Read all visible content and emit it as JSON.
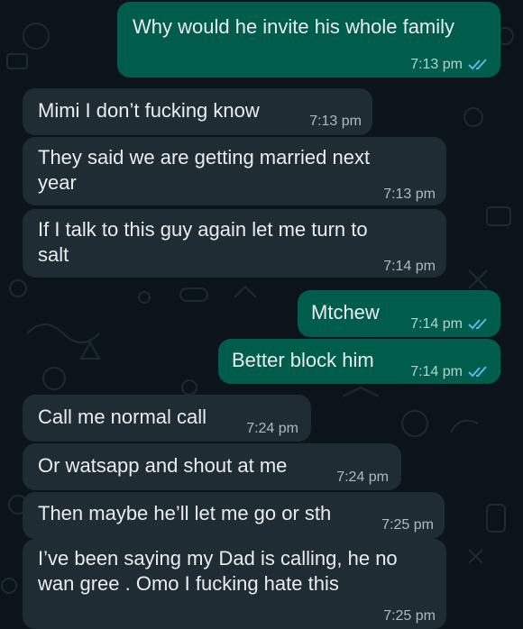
{
  "colors": {
    "background": "#0b141a",
    "outgoing_bubble": "#005c4b",
    "incoming_bubble": "#202c33",
    "read_ticks": "#53bdeb",
    "text": "#e9edef"
  },
  "icons": {
    "read_receipt": "double-check-icon"
  },
  "messages": [
    {
      "direction": "outgoing",
      "lines": [
        "Why would he invite his whole family"
      ],
      "time": "7:13 pm",
      "status": "read"
    },
    {
      "direction": "incoming",
      "lines": [
        "Mimi I don’t fucking know"
      ],
      "time": "7:13 pm"
    },
    {
      "direction": "incoming",
      "lines": [
        "They said we are getting married next",
        "year"
      ],
      "time": "7:13 pm"
    },
    {
      "direction": "incoming",
      "lines": [
        "If I talk to this guy again let me turn to",
        "salt"
      ],
      "time": "7:14 pm"
    },
    {
      "direction": "outgoing",
      "lines": [
        "Mtchew"
      ],
      "time": "7:14 pm",
      "status": "read"
    },
    {
      "direction": "outgoing",
      "lines": [
        "Better block him"
      ],
      "time": "7:14 pm",
      "status": "read"
    },
    {
      "direction": "incoming",
      "lines": [
        "Call me normal call"
      ],
      "time": "7:24 pm"
    },
    {
      "direction": "incoming",
      "lines": [
        "Or watsapp and shout at me"
      ],
      "time": "7:24 pm"
    },
    {
      "direction": "incoming",
      "lines": [
        "Then maybe he’ll let me go or sth"
      ],
      "time": "7:25 pm"
    },
    {
      "direction": "incoming",
      "lines": [
        "I’ve been saying my Dad is calling, he no",
        "wan gree . Omo I fucking hate this"
      ],
      "time": "7:25 pm"
    }
  ]
}
